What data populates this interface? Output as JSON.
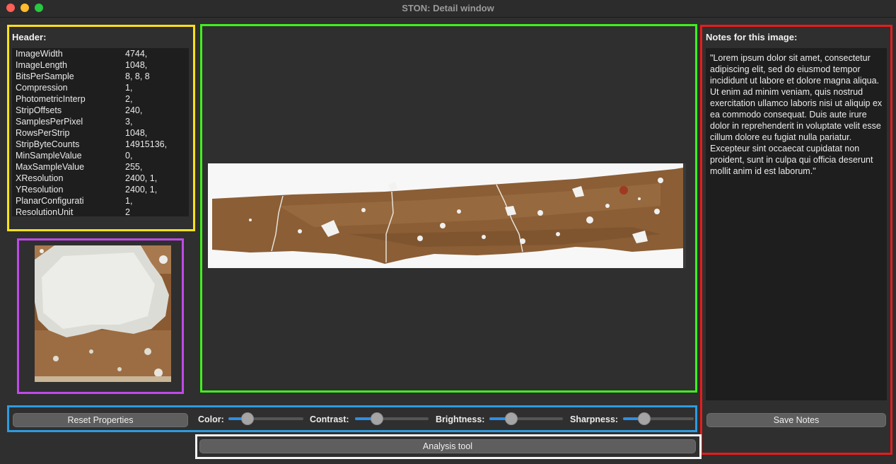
{
  "window": {
    "title": "STON: Detail window"
  },
  "header": {
    "label": "Header:",
    "rows": [
      {
        "key": "ImageWidth",
        "value": "4744,"
      },
      {
        "key": "ImageLength",
        "value": "1048,"
      },
      {
        "key": "BitsPerSample",
        "value": "8, 8, 8"
      },
      {
        "key": "Compression",
        "value": "1,"
      },
      {
        "key": "PhotometricInterp",
        "value": "2,"
      },
      {
        "key": "StripOffsets",
        "value": "240,"
      },
      {
        "key": "SamplesPerPixel",
        "value": "3,"
      },
      {
        "key": "RowsPerStrip",
        "value": "1048,"
      },
      {
        "key": "StripByteCounts",
        "value": "14915136,"
      },
      {
        "key": "MinSampleValue",
        "value": "0,"
      },
      {
        "key": "MaxSampleValue",
        "value": "255,"
      },
      {
        "key": "XResolution",
        "value": "2400, 1,"
      },
      {
        "key": "YResolution",
        "value": "2400, 1,"
      },
      {
        "key": "PlanarConfigurati",
        "value": "1,"
      },
      {
        "key": "ResolutionUnit",
        "value": "2"
      }
    ]
  },
  "notes": {
    "label": "Notes for this image:",
    "text": "\"Lorem ipsum dolor sit amet, consectetur adipiscing elit, sed do eiusmod tempor incididunt ut labore et dolore magna aliqua. Ut enim ad minim veniam, quis nostrud exercitation ullamco laboris nisi ut aliquip ex ea commodo consequat. Duis aute irure dolor in reprehenderit in voluptate velit esse cillum dolore eu fugiat nulla pariatur. Excepteur sint occaecat cupidatat non proident, sunt in culpa qui officia deserunt mollit anim id est laborum.\"",
    "save_label": "Save Notes"
  },
  "controls": {
    "reset_label": "Reset Properties",
    "sliders": [
      {
        "id": "color",
        "label": "Color:",
        "level": 0.2
      },
      {
        "id": "contrast",
        "label": "Contrast:",
        "level": 0.25
      },
      {
        "id": "brightness",
        "label": "Brightness:",
        "level": 0.25
      },
      {
        "id": "sharpness",
        "label": "Sharpness:",
        "level": 0.25
      }
    ]
  },
  "analysis": {
    "label": "Analysis tool"
  },
  "colors": {
    "accent": "#2f8ee5",
    "box_header": "#ffe11a",
    "box_thumbnail": "#c04ae8",
    "box_image": "#3ff01c",
    "box_notes": "#ea1b1b",
    "box_controls": "#2e9be0",
    "box_analysis": "#f4f4f4"
  }
}
